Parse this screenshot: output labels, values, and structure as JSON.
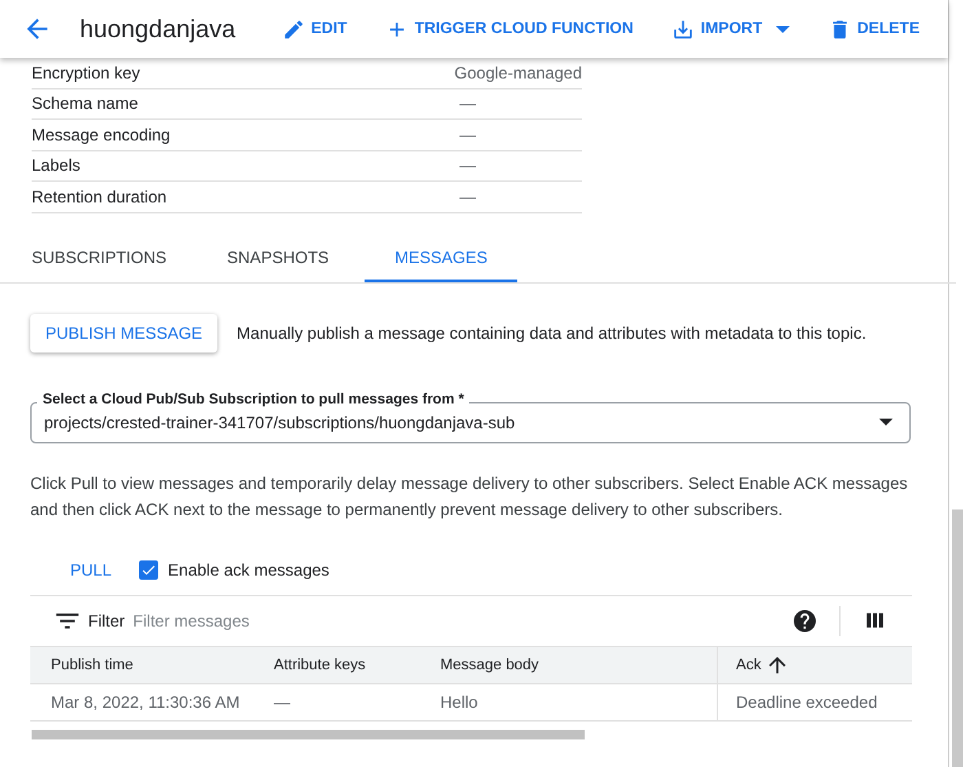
{
  "header": {
    "title": "huongdanjava",
    "actions": [
      {
        "kind": "edit",
        "label": "EDIT"
      },
      {
        "kind": "add",
        "label": "TRIGGER CLOUD FUNCTION"
      },
      {
        "kind": "import",
        "label": "IMPORT"
      },
      {
        "kind": "delete",
        "label": "DELETE"
      }
    ]
  },
  "properties": [
    {
      "label": "Encryption key",
      "value": "Google-managed"
    },
    {
      "label": "Schema name",
      "value": "—"
    },
    {
      "label": "Message encoding",
      "value": "—"
    },
    {
      "label": "Labels",
      "value": "—"
    },
    {
      "label": "Retention duration",
      "value": "—"
    }
  ],
  "tabs": [
    {
      "label": "SUBSCRIPTIONS",
      "selected": false
    },
    {
      "label": "SNAPSHOTS",
      "selected": false
    },
    {
      "label": "MESSAGES",
      "selected": true
    }
  ],
  "publish": {
    "button": "PUBLISH MESSAGE",
    "description": "Manually publish a message containing data and attributes with metadata to this topic."
  },
  "subscription_select": {
    "label": "Select a Cloud Pub/Sub Subscription to pull messages from *",
    "value": "projects/crested-trainer-341707/subscriptions/huongdanjava-sub"
  },
  "help_text": "Click Pull to view messages and temporarily delay message delivery to other subscribers. Select Enable ACK messages and then click ACK next to the message to permanently prevent message delivery to other subscribers.",
  "pull": {
    "button": "PULL",
    "checkbox": {
      "label": "Enable ack messages",
      "checked": true
    }
  },
  "filter": {
    "label": "Filter",
    "placeholder": "Filter messages"
  },
  "table": {
    "columns": [
      {
        "label": "Publish time",
        "sorted": false
      },
      {
        "label": "Attribute keys",
        "sorted": false
      },
      {
        "label": "Message body",
        "sorted": false
      },
      {
        "label": "Ack",
        "sorted": true
      }
    ],
    "rows": [
      [
        "Mar 8, 2022, 11:30:36 AM",
        "—",
        "Hello",
        "Deadline exceeded"
      ]
    ]
  }
}
